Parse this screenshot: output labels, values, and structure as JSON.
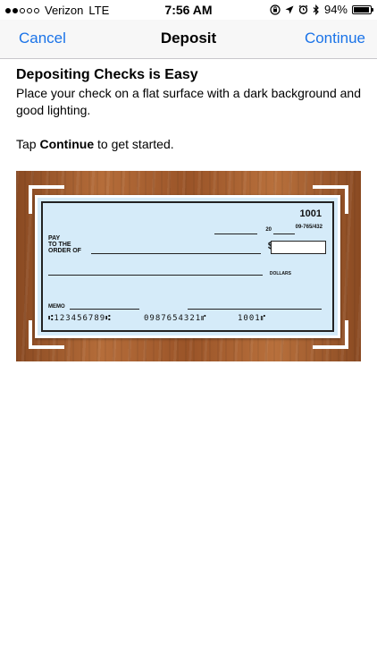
{
  "status_bar": {
    "carrier": "Verizon",
    "network": "LTE",
    "time": "7:56 AM",
    "battery": "94%",
    "battery_level": 0.94,
    "signal_bars_filled": 2,
    "signal_bars_total": 5
  },
  "nav": {
    "left_label": "Cancel",
    "title": "Deposit",
    "right_label": "Continue"
  },
  "content": {
    "heading": "Depositing Checks is Easy",
    "body": "Place your check on a flat surface with a dark background and good lighting.",
    "tap_prefix": "Tap ",
    "tap_bold": "Continue",
    "tap_suffix": " to get started."
  },
  "check": {
    "number": "1001",
    "routing_fraction": "09-765/432",
    "date_suffix": "20",
    "pay_line1": "PAY",
    "pay_line2": "TO THE",
    "pay_line3": "ORDER OF",
    "dollar_sign": "$",
    "dollars_label": "DOLLARS",
    "memo_label": "MEMO",
    "micr_routing": "⑆123456789⑆",
    "micr_account": "0987654321⑈",
    "micr_check": "1001⑈"
  },
  "colors": {
    "accent": "#1a73e8",
    "check_bg": "#d5ebf9",
    "wood": "#a8612f"
  }
}
